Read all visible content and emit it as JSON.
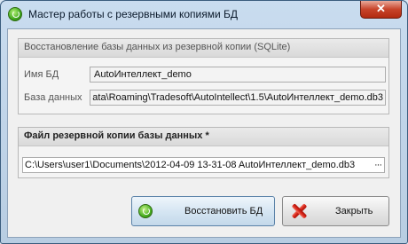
{
  "window": {
    "title": "Мастер работы с резервными копиями БД",
    "close_glyph": "✕"
  },
  "restore_group": {
    "title": "Восстановление базы данных из резервной копии (SQLite)",
    "db_name_label": "Имя БД",
    "db_name_value": "AutoИнтеллект_demo",
    "db_path_label": "База данных",
    "db_path_value": "ata\\Roaming\\Tradesoft\\AutoIntellect\\1.5\\AutoИнтеллект_demo.db3"
  },
  "backup_group": {
    "title": "Файл резервной копии базы данных *",
    "file_path_value": "C:\\Users\\user1\\Documents\\2012-04-09 13-31-08 AutoИнтеллект_demo.db3",
    "browse_glyph": "···"
  },
  "buttons": {
    "restore_label": "Восстановить БД",
    "close_label": "Закрыть"
  },
  "icons": {
    "app": "restore-db-icon",
    "restore": "restore-db-icon",
    "close": "red-x-icon"
  }
}
